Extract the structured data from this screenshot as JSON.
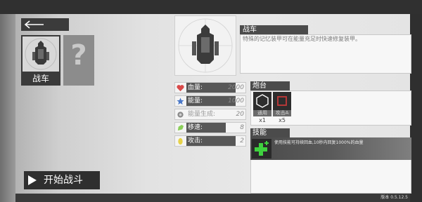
{
  "header": {
    "back_icon": "back-arrow-icon"
  },
  "garage": {
    "vehicles": [
      {
        "name": "战车",
        "selected": true
      },
      {
        "name": "",
        "locked": true,
        "symbol": "?"
      }
    ]
  },
  "start_button": {
    "label": "开始战斗",
    "icon": "play-arrow-icon"
  },
  "vehicle": {
    "name": "战车",
    "description": "特殊的记忆装甲可在能量充足时快速修复装甲。"
  },
  "stats": [
    {
      "icon": "heart-icon",
      "icon_color": "#d94a4a",
      "label": "血量:",
      "value": "2000"
    },
    {
      "icon": "star-icon",
      "icon_color": "#4a78c8",
      "label": "能量:",
      "value": "1000"
    },
    {
      "icon": "energy-regen-icon",
      "icon_color": "#8a8a8a",
      "label": "能量生成:",
      "value": "20"
    },
    {
      "icon": "speed-icon",
      "icon_color": "#8bcf5a",
      "label": "移速:",
      "value": "8",
      "fill": 0.8
    },
    {
      "icon": "attack-icon",
      "icon_color": "#e6d24a",
      "label": "攻击:",
      "value": "2"
    }
  ],
  "turrets": {
    "title": "炮台",
    "items": [
      {
        "tag": "通用",
        "count": "x1",
        "icon": "hexagon-icon"
      },
      {
        "tag": "攻击A",
        "count": "x5",
        "icon": "red-square-icon",
        "color": "#c23a3a"
      }
    ]
  },
  "skills": {
    "title": "技能",
    "items": [
      {
        "icon": "heal-plus-icon",
        "color": "#3fd13f",
        "description": "使用技能可持续回血,10秒内回复1000%的血量"
      }
    ]
  },
  "footer": {
    "version": "版本 0.5.12.5"
  }
}
